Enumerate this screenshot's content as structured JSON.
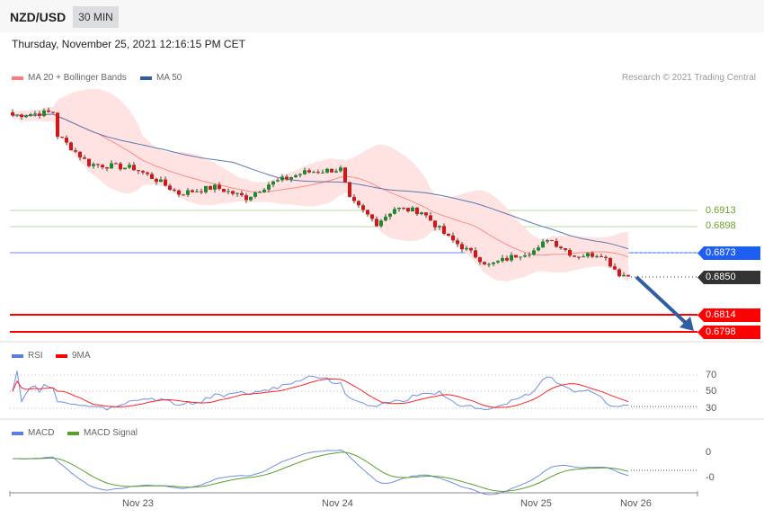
{
  "header": {
    "symbol": "NZD/USD",
    "timeframe": "30 MIN",
    "datetime": "Thursday, November 25, 2021 12:16:15 PM CET"
  },
  "legend": {
    "ma20": "MA 20 + Bollinger Bands",
    "ma50": "MA 50",
    "credit": "Research © 2021 Trading Central",
    "ma20_color": "#ff7b7b",
    "ma50_color": "#2f5fa0"
  },
  "levels": {
    "r2": "0.6913",
    "r1": "0.6898",
    "pivot": "0.6873",
    "last": "0.6850",
    "s1": "0.6814",
    "s2": "0.6798"
  },
  "rsi": {
    "label": "RSI",
    "ma_label": "9MA",
    "levels": [
      "70",
      "50",
      "30"
    ]
  },
  "macd": {
    "label": "MACD",
    "signal_label": "MACD Signal",
    "levels": [
      "0",
      "-0"
    ]
  },
  "xaxis": [
    "Nov 23",
    "Nov 24",
    "Nov 25",
    "Nov 26"
  ],
  "chart_data": {
    "type": "candlestick",
    "price_range": [
      0.6785,
      0.701
    ],
    "waypoints": [
      [
        0,
        0.7003
      ],
      [
        9,
        0.7006
      ],
      [
        10,
        0.6984
      ],
      [
        17,
        0.6957
      ],
      [
        27,
        0.6953
      ],
      [
        32,
        0.6942
      ],
      [
        37,
        0.6929
      ],
      [
        45,
        0.6935
      ],
      [
        52,
        0.6925
      ],
      [
        57,
        0.6938
      ],
      [
        65,
        0.6949
      ],
      [
        73,
        0.6952
      ],
      [
        75,
        0.6923
      ],
      [
        81,
        0.6901
      ],
      [
        85,
        0.6915
      ],
      [
        91,
        0.6912
      ],
      [
        97,
        0.6887
      ],
      [
        103,
        0.687
      ],
      [
        106,
        0.6861
      ],
      [
        113,
        0.6872
      ],
      [
        117,
        0.6876
      ],
      [
        119,
        0.6887
      ],
      [
        125,
        0.687
      ],
      [
        131,
        0.6872
      ],
      [
        135,
        0.6853
      ],
      [
        137,
        0.6851
      ]
    ]
  }
}
